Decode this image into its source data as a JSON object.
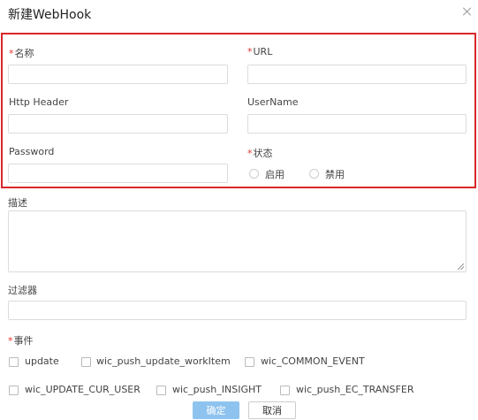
{
  "dialog": {
    "title": "新建WebHook"
  },
  "form": {
    "required_mark": "*",
    "name": {
      "label": "名称",
      "value": "",
      "placeholder": ""
    },
    "url": {
      "label": "URL",
      "value": "",
      "placeholder": ""
    },
    "http_header": {
      "label": "Http Header",
      "value": "",
      "placeholder": ""
    },
    "username": {
      "label": "UserName",
      "value": "",
      "placeholder": ""
    },
    "password": {
      "label": "Password",
      "value": "",
      "placeholder": ""
    },
    "status": {
      "label": "状态",
      "options": [
        "启用",
        "禁用"
      ],
      "selected": null
    },
    "description": {
      "label": "描述",
      "value": ""
    },
    "filter": {
      "label": "过滤器",
      "value": ""
    },
    "events": {
      "label": "事件",
      "options": [
        "update",
        "wic_push_update_workItem",
        "wic_COMMON_EVENT",
        "wic_UPDATE_CUR_USER",
        "wic_push_INSIGHT",
        "wic_push_EC_TRANSFER"
      ]
    }
  },
  "buttons": {
    "ok": "确定",
    "cancel": "取消"
  },
  "colors": {
    "required": "#e6342a",
    "highlight_border": "#d9262a",
    "primary_button": "#8ec3ef"
  }
}
